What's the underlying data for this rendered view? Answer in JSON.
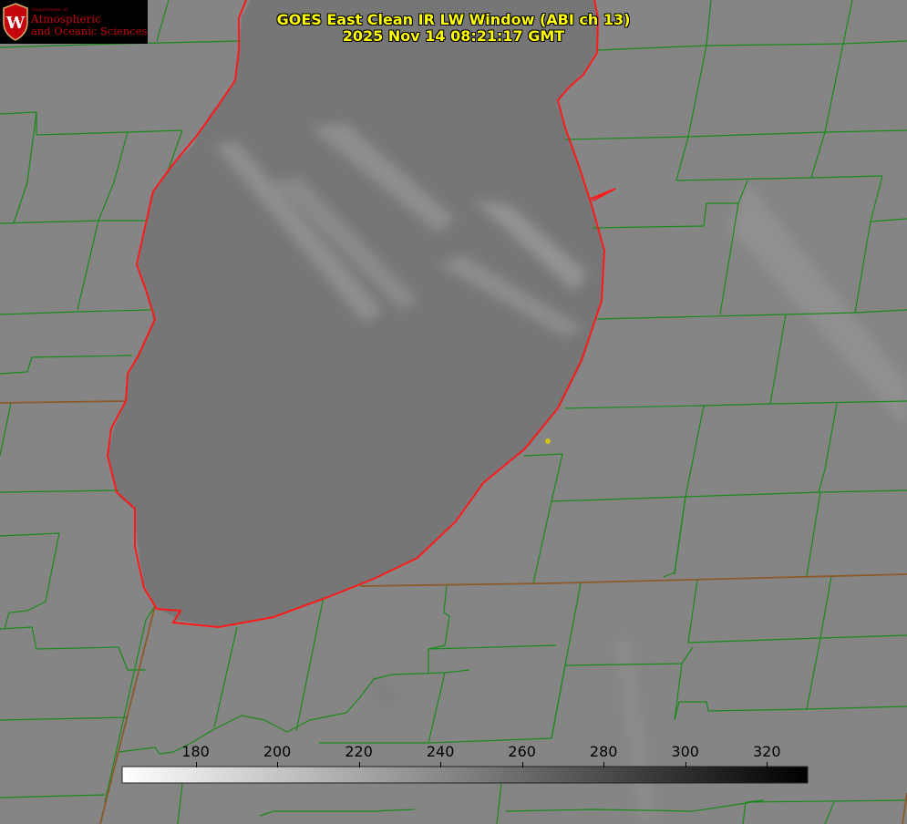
{
  "title": {
    "line1": "GOES East Clean IR LW Window (ABI ch 13)",
    "line2": "2025 Nov 14 08:21:17 GMT"
  },
  "logo": {
    "department": "Department of",
    "line1": "Atmospheric",
    "line2": "and Oceanic Sciences",
    "crest_letter": "W"
  },
  "colorbar": {
    "min": 162,
    "max": 330,
    "colormap": "white (cold) to black (warm)",
    "ticks": [
      {
        "value": 180,
        "label": "180"
      },
      {
        "value": 200,
        "label": "200"
      },
      {
        "value": 220,
        "label": "220"
      },
      {
        "value": 240,
        "label": "240"
      },
      {
        "value": 260,
        "label": "260"
      },
      {
        "value": 280,
        "label": "280"
      },
      {
        "value": 300,
        "label": "300"
      },
      {
        "value": 320,
        "label": "320"
      }
    ]
  },
  "colors": {
    "title_text": "#ffff00",
    "county_lines": "#1a8a1a",
    "lake_outline": "#ff1a1a",
    "state_lines": "#8b5a2b",
    "marker": "#d4c21a",
    "land_gray": "#858585",
    "lake_gray": "#767676",
    "cloud_streak": "#9a9a9a"
  }
}
